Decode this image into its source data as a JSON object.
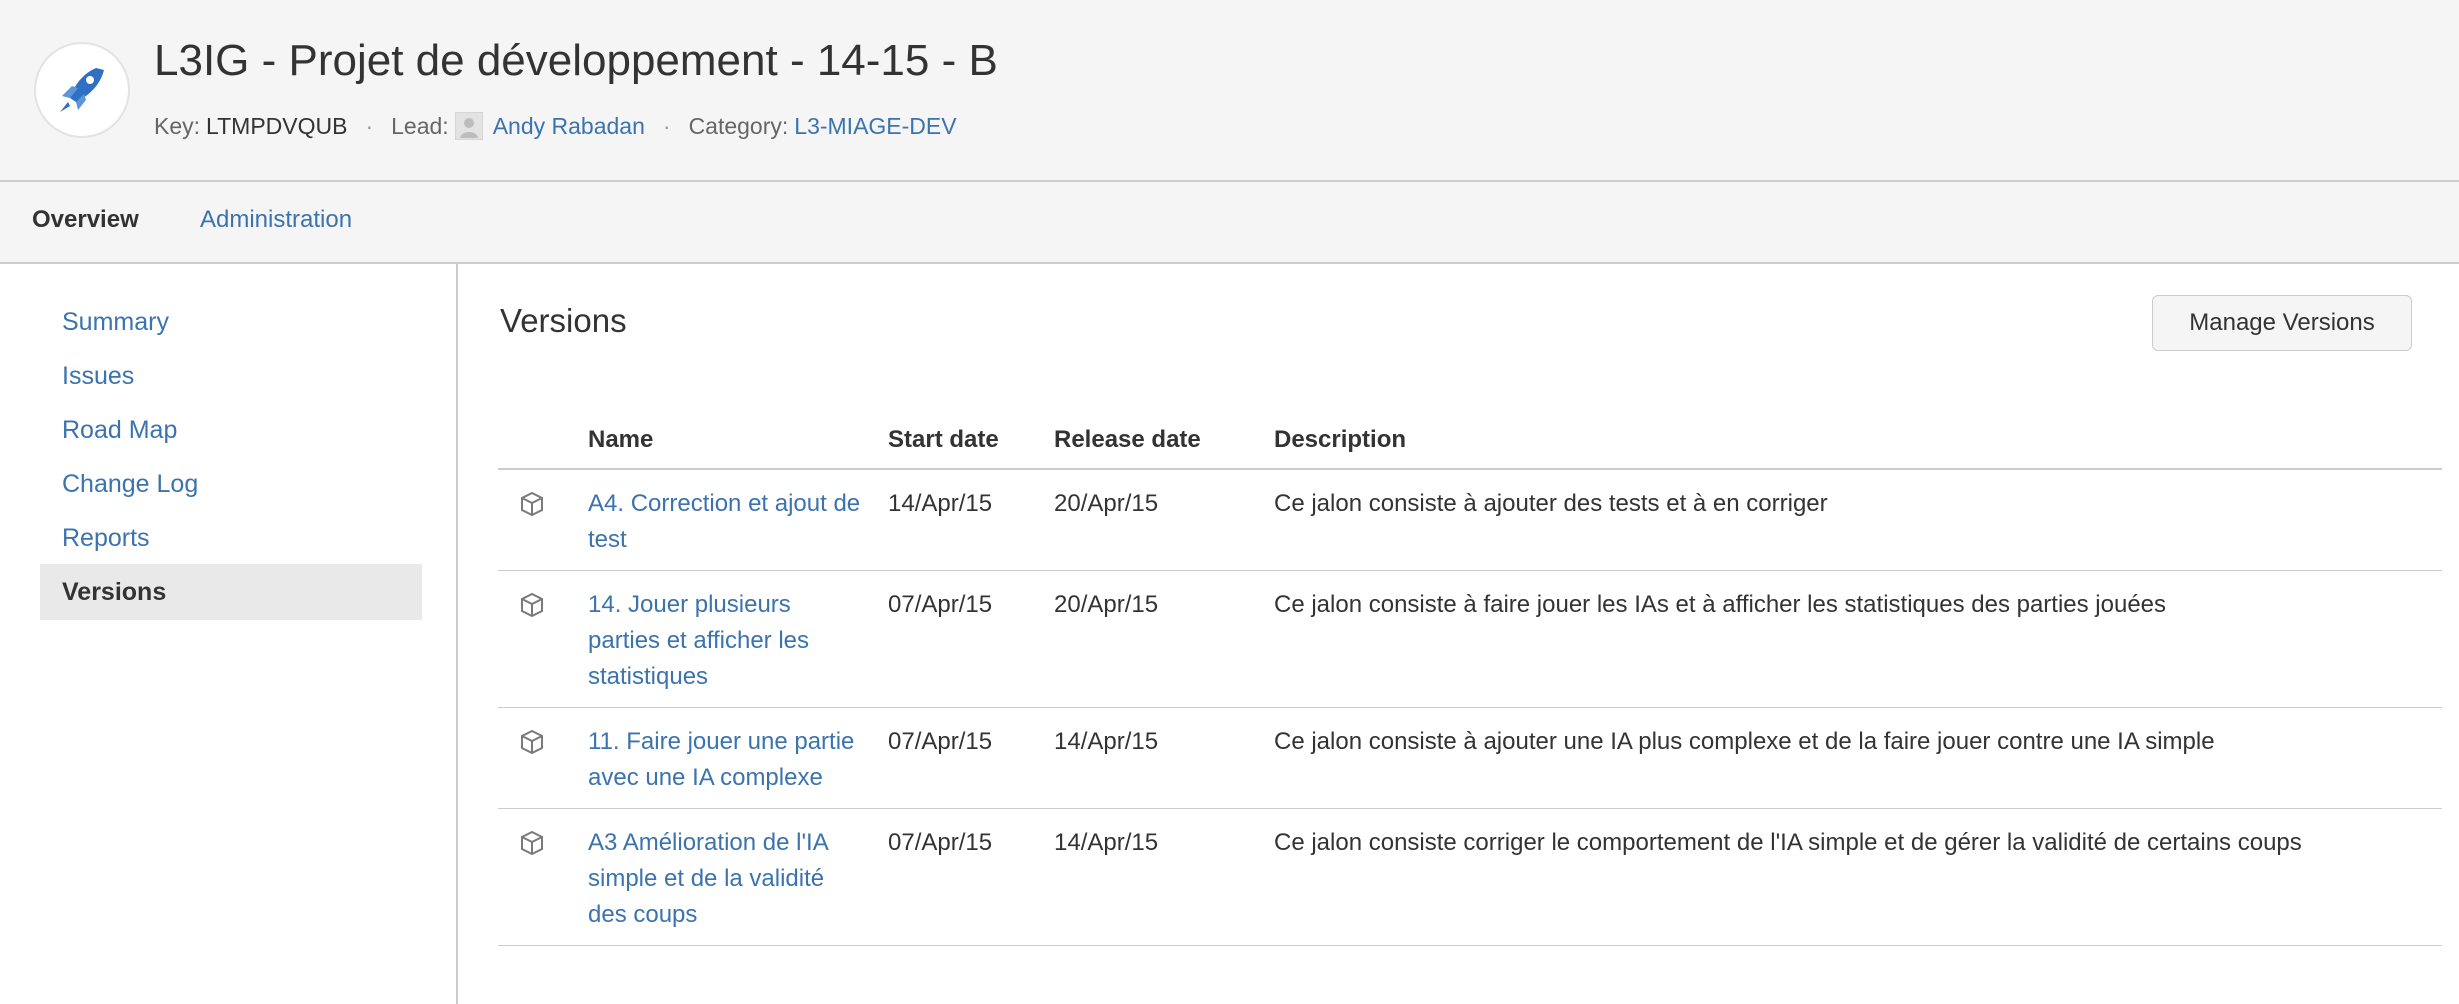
{
  "project": {
    "title": "L3IG - Projet de développement - 14-15 - B",
    "key_label": "Key:",
    "key_value": "LTMPDVQUB",
    "separator": "·",
    "lead_label": "Lead:",
    "lead_name": "Andy Rabadan",
    "category_label": "Category:",
    "category_value": "L3-MIAGE-DEV",
    "avatar_icon": "rocket-icon"
  },
  "nav": {
    "overview": "Overview",
    "administration": "Administration"
  },
  "sidebar": {
    "items": [
      {
        "label": "Summary"
      },
      {
        "label": "Issues"
      },
      {
        "label": "Road Map"
      },
      {
        "label": "Change Log"
      },
      {
        "label": "Reports"
      },
      {
        "label": "Versions",
        "active": true
      }
    ]
  },
  "main": {
    "section_title": "Versions",
    "manage_button": "Manage Versions",
    "columns": {
      "name": "Name",
      "start": "Start date",
      "release": "Release date",
      "description": "Description"
    },
    "rows": [
      {
        "name": "A4. Correction et ajout de test",
        "start": "14/Apr/15",
        "release": "20/Apr/15",
        "description": "Ce jalon consiste à ajouter des tests et à en corriger"
      },
      {
        "name": "14. Jouer plusieurs parties et afficher les statistiques",
        "start": "07/Apr/15",
        "release": "20/Apr/15",
        "description": "Ce jalon consiste à faire jouer les IAs et à afficher les statistiques des parties jouées"
      },
      {
        "name": "11. Faire jouer une partie avec une IA complexe",
        "start": "07/Apr/15",
        "release": "14/Apr/15",
        "description": "Ce jalon consiste à ajouter une IA plus complexe et de la faire jouer contre une IA simple"
      },
      {
        "name": "A3 Amélioration de l'IA simple et de la validité des coups",
        "start": "07/Apr/15",
        "release": "14/Apr/15",
        "description": "Ce jalon consiste corriger le comportement de l'IA simple et de gérer la validité de certains coups"
      }
    ]
  },
  "colors": {
    "link": "#3b73af",
    "header_bg": "#f5f5f5",
    "active_bg": "#e9e9e9",
    "border": "#cccccc"
  }
}
